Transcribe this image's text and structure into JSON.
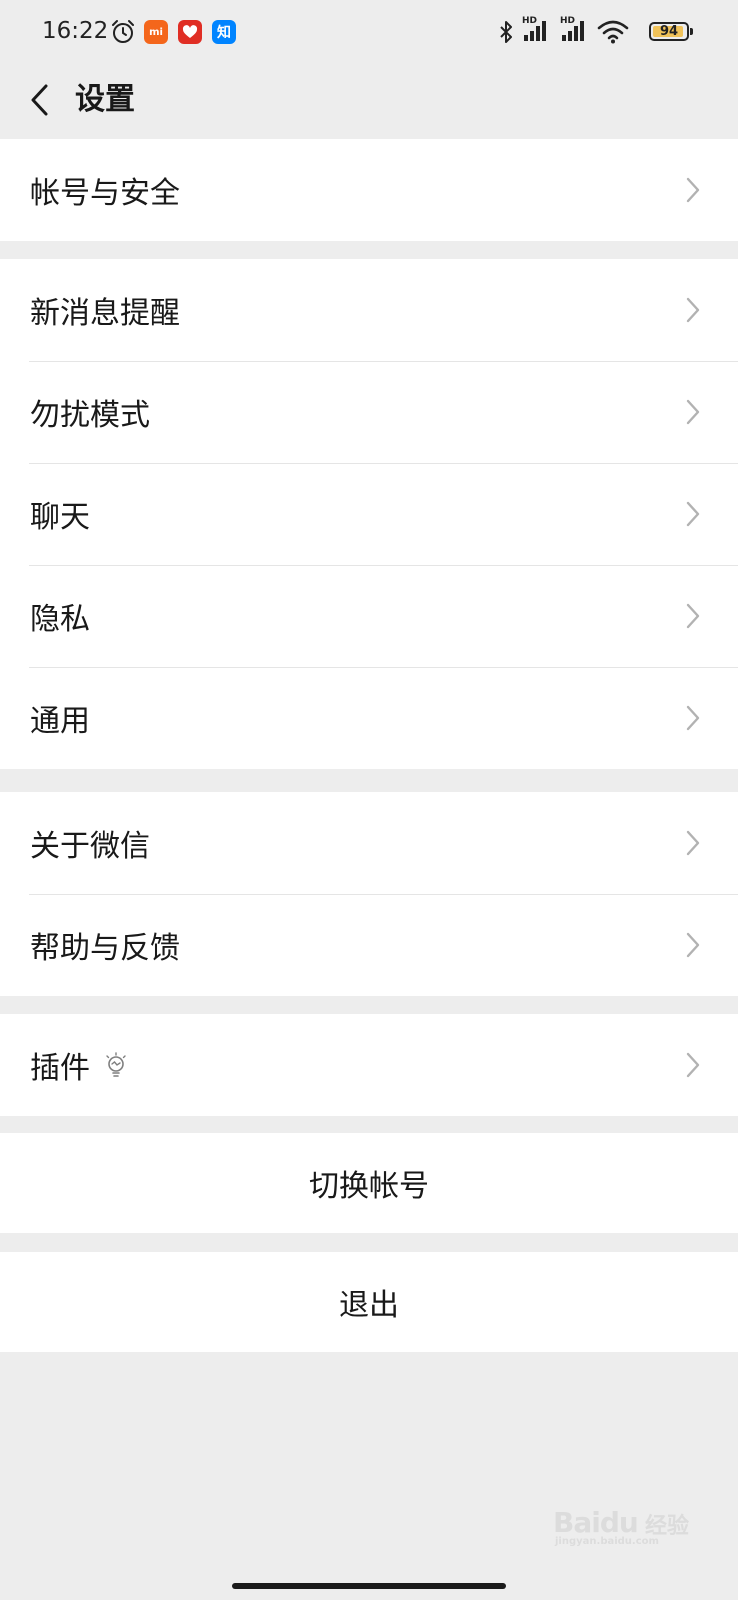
{
  "status_bar": {
    "time": "16:22",
    "battery_level": "94",
    "battery_fraction": 0.94,
    "signal_labels": [
      "HD",
      "HD"
    ],
    "icons": [
      "alarm-icon",
      "mi-app-icon",
      "pinduoduo-app-icon",
      "zhihu-app-icon",
      "bluetooth-icon",
      "signal-icon",
      "signal-icon",
      "wifi-icon",
      "battery-icon"
    ],
    "mi_label": "mi",
    "zhihu_label": "知",
    "colors": {
      "mi": "#f4661b",
      "pinduoduo": "#e02e24",
      "zhihu": "#0084ff"
    }
  },
  "nav": {
    "title": "设置",
    "back_icon": "chevron-left-icon"
  },
  "groups": [
    {
      "items": [
        {
          "label": "帐号与安全"
        }
      ]
    },
    {
      "items": [
        {
          "label": "新消息提醒"
        },
        {
          "label": "勿扰模式"
        },
        {
          "label": "聊天"
        },
        {
          "label": "隐私"
        },
        {
          "label": "通用"
        }
      ]
    },
    {
      "items": [
        {
          "label": "关于微信"
        },
        {
          "label": "帮助与反馈"
        }
      ]
    },
    {
      "items": [
        {
          "label": "插件",
          "icon": "lightbulb-icon"
        }
      ]
    }
  ],
  "actions": {
    "switch_account": "切换帐号",
    "logout": "退出"
  },
  "watermark": {
    "text": "Baidu",
    "cn": "经验",
    "sub": "jingyan.baidu.com"
  }
}
